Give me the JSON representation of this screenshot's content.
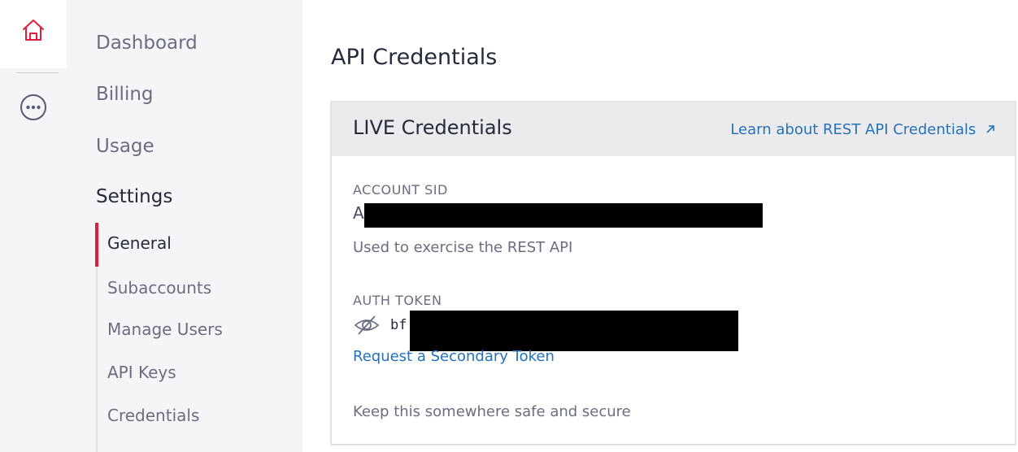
{
  "rail": {
    "home_icon": "home-icon",
    "more_icon": "more-options-icon",
    "accent_color": "#e01e3c"
  },
  "nav": {
    "items": [
      {
        "label": "Dashboard"
      },
      {
        "label": "Billing"
      },
      {
        "label": "Usage"
      },
      {
        "label": "Settings"
      }
    ],
    "subitems": [
      {
        "label": "General",
        "active": true
      },
      {
        "label": "Subaccounts"
      },
      {
        "label": "Manage Users"
      },
      {
        "label": "API Keys"
      },
      {
        "label": "Credentials"
      }
    ]
  },
  "main": {
    "title": "API Credentials",
    "card": {
      "title": "LIVE Credentials",
      "learn_link": "Learn about REST API Credentials",
      "learn_link_icon": "external-link-arrow-icon",
      "account_sid": {
        "label": "ACCOUNT SID",
        "value_visible": "A",
        "help": "Used to exercise the REST API"
      },
      "auth_token": {
        "label": "AUTH TOKEN",
        "visibility_icon": "eye-hidden-icon",
        "value_visible": "bf",
        "secondary_link": "Request a Secondary Token",
        "help": "Keep this somewhere safe and secure"
      }
    }
  },
  "colors": {
    "link": "#2672b8",
    "active_indicator": "#e01e3c",
    "sidebar_bg": "#f5f5f7",
    "card_header_bg": "#ebebed"
  }
}
